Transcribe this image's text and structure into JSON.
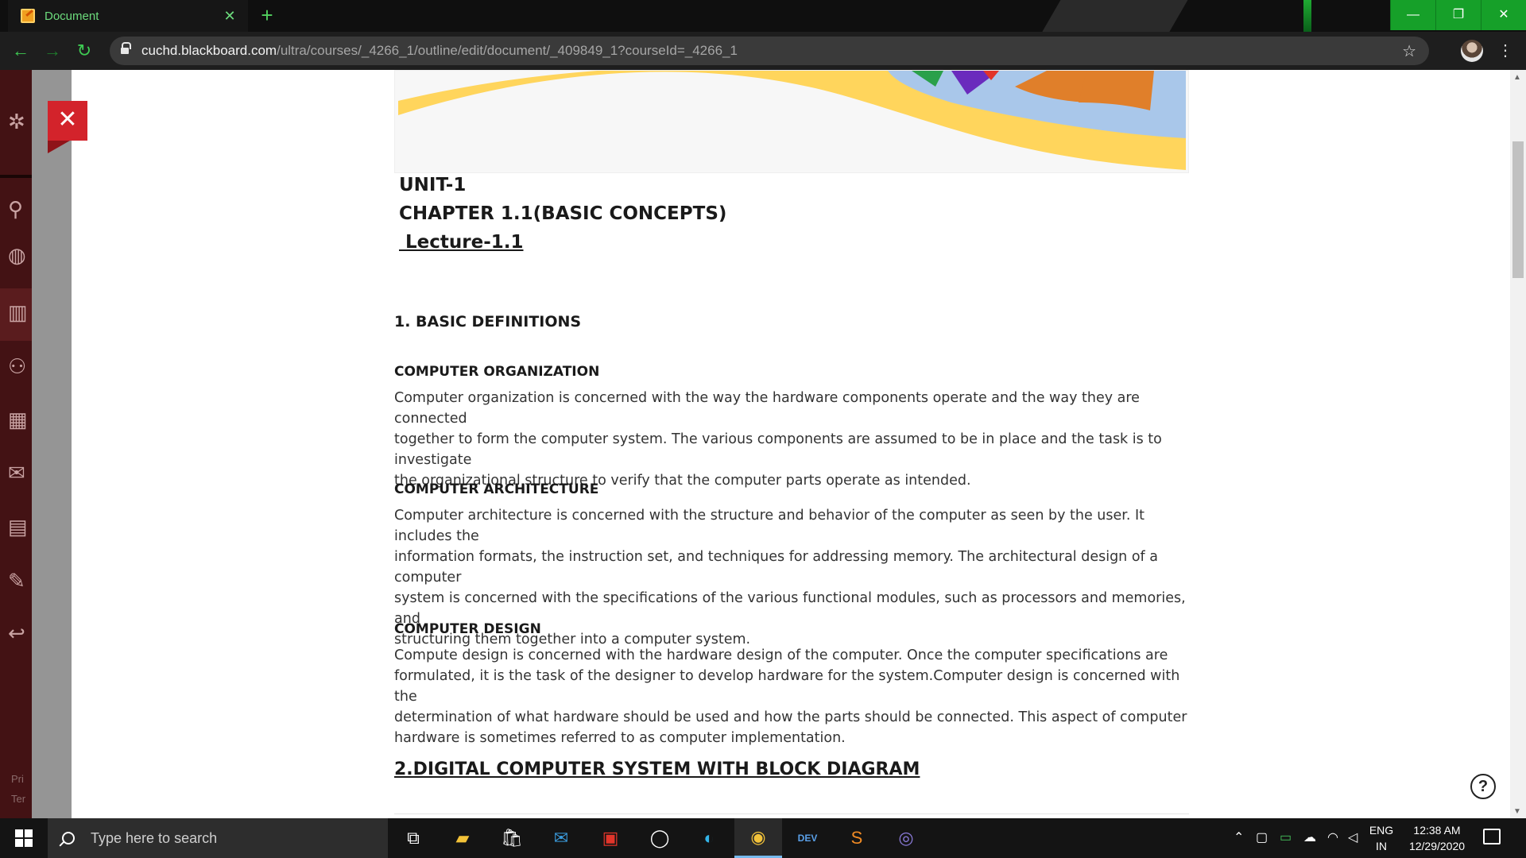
{
  "browser": {
    "tab_title": "Document",
    "tab_close": "✕",
    "new_tab": "+",
    "url_host": "cuchd.blackboard.com",
    "url_path": "/ultra/courses/_4266_1/outline/edit/document/_409849_1?courseId=_4266_1",
    "window_controls": {
      "minimize": "—",
      "restore": "❐",
      "close": "✕"
    },
    "accent_color": "#16a029"
  },
  "left_nav": {
    "footer_items": [
      "Pri",
      "Ter"
    ]
  },
  "panel": {
    "close_label": "✕",
    "close_color": "#d3232b"
  },
  "document": {
    "unit": "UNIT-1",
    "chapter": "CHAPTER 1.1(BASIC CONCEPTS)",
    "lecture": " Lecture-1.1",
    "section1_title": "1. BASIC DEFINITIONS",
    "org_title": "COMPUTER ORGANIZATION",
    "org_lines": [
      "Computer organization is concerned with the way the hardware components operate and the way they are connected",
      "together to form the computer system. The various components are assumed to be in place and the task is to investigate",
      "the organizational structure to verify that the computer parts operate as intended."
    ],
    "arch_title": "COMPUTER ARCHITECTURE",
    "arch_lines": [
      "Computer architecture is concerned with the structure and behavior of the computer as seen by the user. It includes the",
      "information formats, the instruction set, and techniques for addressing memory. The architectural design of a computer",
      "system is concerned with the specifications of the various functional modules, such as processors and memories, and",
      "structuring them together into a computer system."
    ],
    "design_title": "COMPUTER DESIGN",
    "design_lines": [
      "Compute design is concerned with the hardware design of the computer. Once the computer specifications are",
      "formulated, it is the task of the designer to develop hardware for the system.Computer design is concerned with the",
      "determination of what hardware should be used and how the parts should be connected. This aspect of computer",
      "hardware is sometimes referred to as computer implementation."
    ],
    "section2_title": "2.DIGITAL COMPUTER SYSTEM WITH BLOCK DIAGRAM"
  },
  "help": {
    "icon": "?"
  },
  "taskbar": {
    "search_placeholder": "Type here to search",
    "apps": [
      "task-view",
      "file-explorer",
      "store",
      "mail",
      "gift",
      "whatsapp",
      "edge",
      "chrome",
      "dev-cpp",
      "sublime-text",
      "eclipse"
    ],
    "language": [
      "ENG",
      "IN"
    ],
    "time": "12:38 AM",
    "date": "12/29/2020"
  }
}
